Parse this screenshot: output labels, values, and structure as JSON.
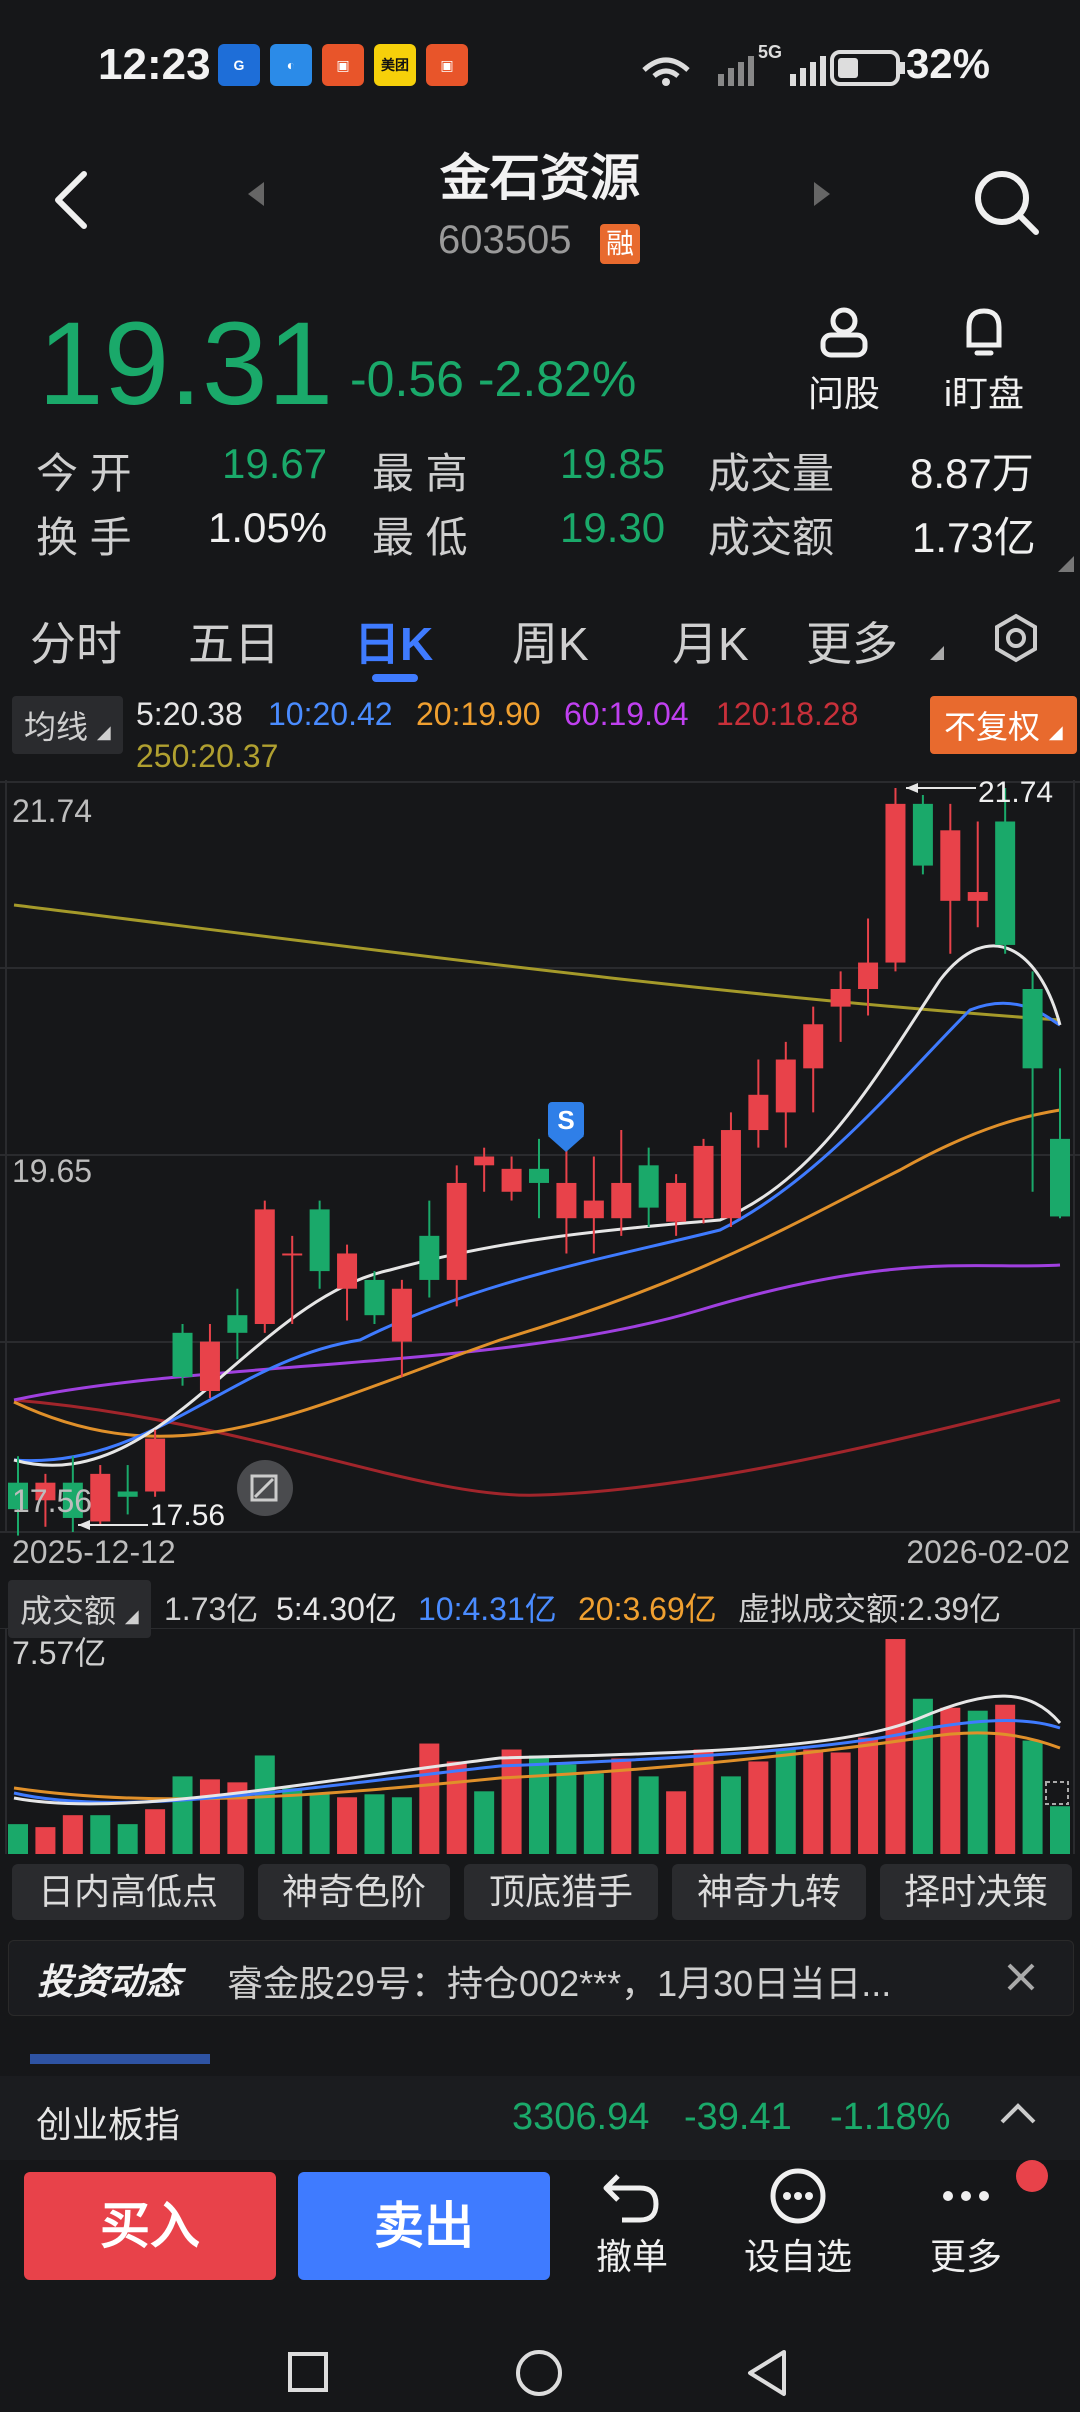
{
  "status_bar": {
    "time": "12:23",
    "apps": [
      "cuponing-app-icon",
      "chat-app-icon",
      "news-app-icon",
      "meituan-app-icon",
      "news2-app-icon"
    ],
    "meituan_label": "美团",
    "network_label": "5G",
    "battery": "32%"
  },
  "header": {
    "title": "金石资源",
    "code": "603505",
    "badge": "融"
  },
  "quote": {
    "price": "19.31",
    "change": "-0.56",
    "change_pct": "-2.82%",
    "actions": [
      {
        "label": "问股",
        "icon": "person-icon"
      },
      {
        "label": "i盯盘",
        "icon": "bell-icon"
      }
    ],
    "rows": [
      {
        "l1": "今  开",
        "v1": "19.67",
        "l2": "最  高",
        "v2": "19.85",
        "l3": "成交量",
        "v3": "8.87万"
      },
      {
        "l1": "换  手",
        "v1": "1.05%",
        "l2": "最  低",
        "v2": "19.30",
        "l3": "成交额",
        "v3": "1.73亿"
      }
    ]
  },
  "tabs": [
    "分时",
    "五日",
    "日K",
    "周K",
    "月K",
    "更多"
  ],
  "active_tab": "日K",
  "ma": {
    "selector": "均线",
    "ma5": "5:20.38",
    "ma10": "10:20.42",
    "ma20": "20:19.90",
    "ma60": "60:19.04",
    "ma120": "120:18.28",
    "ma250": "250:20.37",
    "adjust": "不复权"
  },
  "kline": {
    "high_label": "21.74",
    "mid_label": "19.65",
    "low_label": "17.56",
    "high_marker": "21.74",
    "low_marker": "17.56",
    "start_date": "2025-12-12",
    "end_date": "2026-02-02",
    "signal_badge": "S"
  },
  "volume": {
    "selector": "成交额",
    "today": "1.73亿",
    "ma5": "5:4.30亿",
    "ma10": "10:4.31亿",
    "ma20": "20:3.69亿",
    "virtual": "虚拟成交额:2.39亿",
    "axis_max": "7.57亿"
  },
  "indicators": [
    "日内高低点",
    "神奇色阶",
    "顶底猎手",
    "神奇九转",
    "择时决策"
  ],
  "news": {
    "logo": "投资动态",
    "text": "睿金股29号：持仓002***，1月30日当日..."
  },
  "index_bar": {
    "name": "创业板指",
    "value": "3306.94",
    "change": "-39.41",
    "change_pct": "-1.18%"
  },
  "toolbar": {
    "buy": "买入",
    "sell": "卖出",
    "undo": "撤单",
    "watchlist": "设自选",
    "more": "更多"
  },
  "colors": {
    "up": "#e8424a",
    "down": "#1aa96a",
    "accent": "#3f7bff",
    "orange": "#e86a2e"
  },
  "chart_data": {
    "type": "candlestick",
    "ylim": [
      17.56,
      21.74
    ],
    "candles": [
      {
        "o": 17.8,
        "h": 17.95,
        "l": 17.5,
        "c": 17.65
      },
      {
        "o": 17.7,
        "h": 17.85,
        "l": 17.55,
        "c": 17.8
      },
      {
        "o": 17.8,
        "h": 17.95,
        "l": 17.52,
        "c": 17.6
      },
      {
        "o": 17.58,
        "h": 17.9,
        "l": 17.56,
        "c": 17.85
      },
      {
        "o": 17.75,
        "h": 17.9,
        "l": 17.62,
        "c": 17.72
      },
      {
        "o": 17.75,
        "h": 18.1,
        "l": 17.72,
        "c": 18.05
      },
      {
        "o": 18.65,
        "h": 18.7,
        "l": 18.35,
        "c": 18.4
      },
      {
        "o": 18.32,
        "h": 18.7,
        "l": 18.28,
        "c": 18.6
      },
      {
        "o": 18.75,
        "h": 18.9,
        "l": 18.5,
        "c": 18.65
      },
      {
        "o": 18.7,
        "h": 19.4,
        "l": 18.65,
        "c": 19.35
      },
      {
        "o": 19.1,
        "h": 19.2,
        "l": 18.7,
        "c": 19.1
      },
      {
        "o": 19.35,
        "h": 19.4,
        "l": 18.9,
        "c": 19.0
      },
      {
        "o": 18.9,
        "h": 19.15,
        "l": 18.72,
        "c": 19.1
      },
      {
        "o": 18.95,
        "h": 19.0,
        "l": 18.7,
        "c": 18.75
      },
      {
        "o": 18.6,
        "h": 18.95,
        "l": 18.4,
        "c": 18.9
      },
      {
        "o": 19.2,
        "h": 19.4,
        "l": 18.85,
        "c": 18.95
      },
      {
        "o": 18.95,
        "h": 19.6,
        "l": 18.8,
        "c": 19.5
      },
      {
        "o": 19.6,
        "h": 19.7,
        "l": 19.45,
        "c": 19.65
      },
      {
        "o": 19.45,
        "h": 19.65,
        "l": 19.4,
        "c": 19.58
      },
      {
        "o": 19.58,
        "h": 19.75,
        "l": 19.3,
        "c": 19.5
      },
      {
        "o": 19.3,
        "h": 19.8,
        "l": 19.1,
        "c": 19.5
      },
      {
        "o": 19.3,
        "h": 19.65,
        "l": 19.1,
        "c": 19.4
      },
      {
        "o": 19.3,
        "h": 19.8,
        "l": 19.2,
        "c": 19.5
      },
      {
        "o": 19.6,
        "h": 19.7,
        "l": 19.25,
        "c": 19.36
      },
      {
        "o": 19.28,
        "h": 19.55,
        "l": 19.2,
        "c": 19.5
      },
      {
        "o": 19.3,
        "h": 19.75,
        "l": 19.27,
        "c": 19.71
      },
      {
        "o": 19.3,
        "h": 19.9,
        "l": 19.25,
        "c": 19.8
      },
      {
        "o": 19.8,
        "h": 20.2,
        "l": 19.7,
        "c": 20.0
      },
      {
        "o": 19.9,
        "h": 20.3,
        "l": 19.7,
        "c": 20.2
      },
      {
        "o": 20.15,
        "h": 20.5,
        "l": 19.9,
        "c": 20.4
      },
      {
        "o": 20.5,
        "h": 20.7,
        "l": 20.3,
        "c": 20.6
      },
      {
        "o": 20.6,
        "h": 21.0,
        "l": 20.45,
        "c": 20.75
      },
      {
        "o": 20.75,
        "h": 21.74,
        "l": 20.7,
        "c": 21.65
      },
      {
        "o": 21.65,
        "h": 21.7,
        "l": 21.25,
        "c": 21.3
      },
      {
        "o": 21.1,
        "h": 21.65,
        "l": 20.8,
        "c": 21.5
      },
      {
        "o": 21.1,
        "h": 21.55,
        "l": 20.95,
        "c": 21.15
      },
      {
        "o": 21.55,
        "h": 21.74,
        "l": 20.8,
        "c": 20.85
      },
      {
        "o": 20.6,
        "h": 20.7,
        "l": 19.45,
        "c": 20.15
      },
      {
        "o": 19.75,
        "h": 20.15,
        "l": 19.3,
        "c": 19.31
      }
    ],
    "volume_max": 7.57,
    "volumes": [
      1.0,
      0.9,
      1.3,
      1.3,
      1.0,
      1.5,
      2.6,
      2.5,
      2.4,
      3.3,
      2.2,
      2.0,
      1.9,
      2.0,
      1.9,
      3.7,
      3.1,
      2.1,
      3.5,
      3.3,
      3.0,
      2.7,
      3.2,
      2.6,
      2.1,
      3.5,
      2.6,
      3.1,
      3.5,
      3.5,
      3.4,
      3.9,
      7.2,
      5.2,
      4.9,
      4.8,
      5.0,
      3.8,
      1.6
    ],
    "volume_up": [
      false,
      true,
      true,
      false,
      false,
      true,
      false,
      true,
      true,
      false,
      false,
      false,
      true,
      false,
      false,
      true,
      true,
      false,
      true,
      false,
      false,
      false,
      true,
      false,
      true,
      true,
      false,
      true,
      false,
      true,
      true,
      true,
      true,
      false,
      true,
      false,
      true,
      false,
      false
    ]
  }
}
